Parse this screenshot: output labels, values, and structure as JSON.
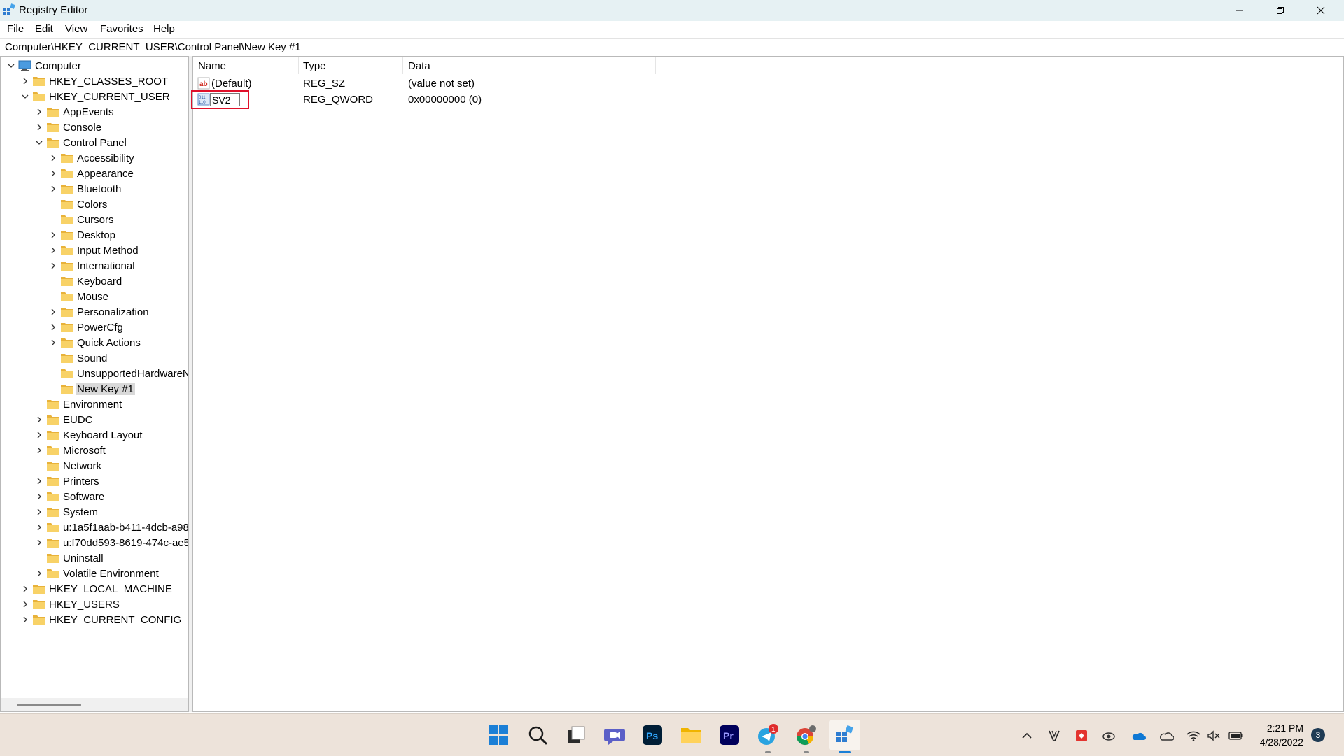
{
  "window": {
    "title": "Registry Editor",
    "controls": [
      "minimize",
      "restore",
      "close"
    ]
  },
  "menu": [
    "File",
    "Edit",
    "View",
    "Favorites",
    "Help"
  ],
  "address": "Computer\\HKEY_CURRENT_USER\\Control Panel\\New Key #1",
  "tree": [
    {
      "label": "Computer",
      "expander": "expanded",
      "icon": "computer-icon"
    },
    {
      "label": "HKEY_CLASSES_ROOT",
      "expander": "collapsed",
      "icon": "folder-icon"
    },
    {
      "label": "HKEY_CURRENT_USER",
      "expander": "expanded",
      "icon": "folder-icon"
    },
    {
      "label": "AppEvents",
      "expander": "collapsed",
      "icon": "folder-icon"
    },
    {
      "label": "Console",
      "expander": "collapsed",
      "icon": "folder-icon"
    },
    {
      "label": "Control Panel",
      "expander": "expanded",
      "icon": "folder-icon"
    },
    {
      "label": "Accessibility",
      "expander": "collapsed",
      "icon": "folder-icon"
    },
    {
      "label": "Appearance",
      "expander": "collapsed",
      "icon": "folder-icon"
    },
    {
      "label": "Bluetooth",
      "expander": "collapsed",
      "icon": "folder-icon"
    },
    {
      "label": "Colors",
      "expander": "none",
      "icon": "folder-icon"
    },
    {
      "label": "Cursors",
      "expander": "none",
      "icon": "folder-icon"
    },
    {
      "label": "Desktop",
      "expander": "collapsed",
      "icon": "folder-icon"
    },
    {
      "label": "Input Method",
      "expander": "collapsed",
      "icon": "folder-icon"
    },
    {
      "label": "International",
      "expander": "collapsed",
      "icon": "folder-icon"
    },
    {
      "label": "Keyboard",
      "expander": "none",
      "icon": "folder-icon"
    },
    {
      "label": "Mouse",
      "expander": "none",
      "icon": "folder-icon"
    },
    {
      "label": "Personalization",
      "expander": "collapsed",
      "icon": "folder-icon"
    },
    {
      "label": "PowerCfg",
      "expander": "collapsed",
      "icon": "folder-icon"
    },
    {
      "label": "Quick Actions",
      "expander": "collapsed",
      "icon": "folder-icon"
    },
    {
      "label": "Sound",
      "expander": "none",
      "icon": "folder-icon"
    },
    {
      "label": "UnsupportedHardwareN",
      "expander": "none",
      "icon": "folder-icon"
    },
    {
      "label": "New Key #1",
      "expander": "none",
      "icon": "folder-icon",
      "selected": true
    },
    {
      "label": "Environment",
      "expander": "none",
      "icon": "folder-icon"
    },
    {
      "label": "EUDC",
      "expander": "collapsed",
      "icon": "folder-icon"
    },
    {
      "label": "Keyboard Layout",
      "expander": "collapsed",
      "icon": "folder-icon"
    },
    {
      "label": "Microsoft",
      "expander": "collapsed",
      "icon": "folder-icon"
    },
    {
      "label": "Network",
      "expander": "none",
      "icon": "folder-icon"
    },
    {
      "label": "Printers",
      "expander": "collapsed",
      "icon": "folder-icon"
    },
    {
      "label": "Software",
      "expander": "collapsed",
      "icon": "folder-icon"
    },
    {
      "label": "System",
      "expander": "collapsed",
      "icon": "folder-icon"
    },
    {
      "label": "u:1a5f1aab-b411-4dcb-a98",
      "expander": "collapsed",
      "icon": "folder-icon"
    },
    {
      "label": "u:f70dd593-8619-474c-ae5",
      "expander": "collapsed",
      "icon": "folder-icon"
    },
    {
      "label": "Uninstall",
      "expander": "none",
      "icon": "folder-icon"
    },
    {
      "label": "Volatile Environment",
      "expander": "collapsed",
      "icon": "folder-icon"
    },
    {
      "label": "HKEY_LOCAL_MACHINE",
      "expander": "collapsed",
      "icon": "folder-icon"
    },
    {
      "label": "HKEY_USERS",
      "expander": "collapsed",
      "icon": "folder-icon"
    },
    {
      "label": "HKEY_CURRENT_CONFIG",
      "expander": "collapsed",
      "icon": "folder-icon"
    }
  ],
  "columns": [
    "Name",
    "Type",
    "Data"
  ],
  "values": [
    {
      "name": "(Default)",
      "type": "REG_SZ",
      "data": "(value not set)",
      "icon": "string-value-icon"
    },
    {
      "name": "SV2",
      "type": "REG_QWORD",
      "data": "0x00000000 (0)",
      "icon": "binary-value-icon",
      "editing": true
    }
  ],
  "highlight_color": "#e0102a",
  "taskbar": {
    "apps": [
      {
        "name": "start-button",
        "icon": "windows-logo-icon"
      },
      {
        "name": "search-button",
        "icon": "search-icon"
      },
      {
        "name": "task-view-button",
        "icon": "task-view-icon"
      },
      {
        "name": "teams-chat-button",
        "icon": "chat-icon"
      },
      {
        "name": "photoshop-button",
        "icon": "photoshop-icon",
        "label": "Ps"
      },
      {
        "name": "file-explorer-button",
        "icon": "folder-icon"
      },
      {
        "name": "premiere-button",
        "icon": "premiere-icon",
        "label": "Pr"
      },
      {
        "name": "telegram-button",
        "icon": "telegram-icon",
        "badge": "1"
      },
      {
        "name": "chrome-button",
        "icon": "chrome-icon"
      },
      {
        "name": "regedit-button",
        "icon": "registry-editor-icon",
        "active": true
      }
    ],
    "tray": {
      "time": "2:21 PM",
      "date": "4/28/2022",
      "notifications": "3",
      "icons": [
        "chevron-up-icon",
        "vpn-icon",
        "app-tray-icon",
        "cloud-sync-icon",
        "onedrive-icon",
        "onedrive-personal-icon",
        "wifi-icon",
        "volume-muted-icon",
        "battery-icon"
      ]
    }
  }
}
